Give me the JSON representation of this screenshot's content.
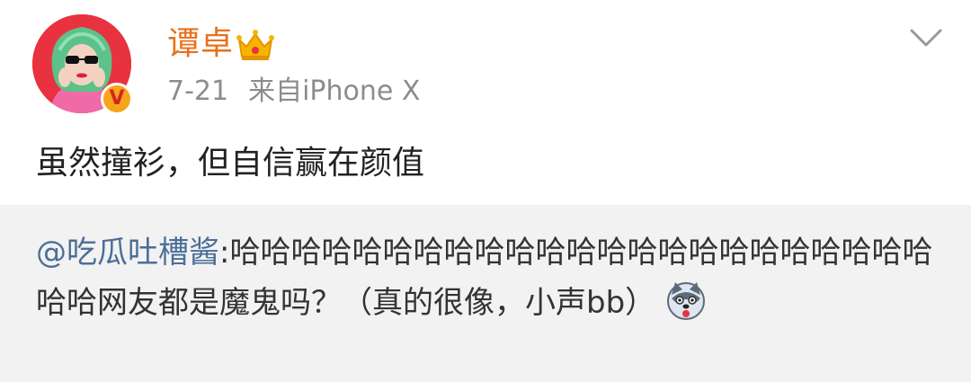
{
  "post": {
    "username": "谭卓",
    "date": "7-21",
    "source": "来自iPhone X",
    "verified_label": "V",
    "text": "虽然撞衫，但自信赢在颜值"
  },
  "repost": {
    "mention": "@吃瓜吐槽酱",
    "separator": ":",
    "text": "哈哈哈哈哈哈哈哈哈哈哈哈哈哈哈哈哈哈哈哈哈哈哈哈哈网友都是魔鬼吗？（真的很像，小声bb）"
  },
  "icons": {
    "badge": "crown-icon",
    "menu": "chevron-down-icon",
    "emoji": "husky-dog-emoji-icon"
  },
  "colors": {
    "username": "#e8701a",
    "mention": "#4a6f98",
    "meta": "#8c8c8c",
    "repost_bg": "#f2f2f2",
    "avatar_bg": "#e8323f"
  }
}
